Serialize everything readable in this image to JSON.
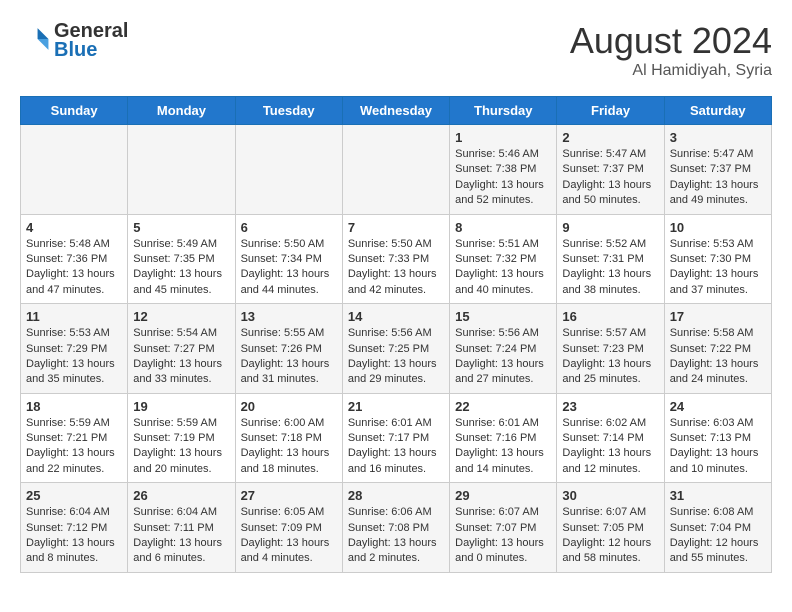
{
  "header": {
    "logo_line1": "General",
    "logo_line2": "Blue",
    "month_year": "August 2024",
    "location": "Al Hamidiyah, Syria"
  },
  "days_of_week": [
    "Sunday",
    "Monday",
    "Tuesday",
    "Wednesday",
    "Thursday",
    "Friday",
    "Saturday"
  ],
  "weeks": [
    [
      {
        "day": "",
        "text": ""
      },
      {
        "day": "",
        "text": ""
      },
      {
        "day": "",
        "text": ""
      },
      {
        "day": "",
        "text": ""
      },
      {
        "day": "1",
        "text": "Sunrise: 5:46 AM\nSunset: 7:38 PM\nDaylight: 13 hours\nand 52 minutes."
      },
      {
        "day": "2",
        "text": "Sunrise: 5:47 AM\nSunset: 7:37 PM\nDaylight: 13 hours\nand 50 minutes."
      },
      {
        "day": "3",
        "text": "Sunrise: 5:47 AM\nSunset: 7:37 PM\nDaylight: 13 hours\nand 49 minutes."
      }
    ],
    [
      {
        "day": "4",
        "text": "Sunrise: 5:48 AM\nSunset: 7:36 PM\nDaylight: 13 hours\nand 47 minutes."
      },
      {
        "day": "5",
        "text": "Sunrise: 5:49 AM\nSunset: 7:35 PM\nDaylight: 13 hours\nand 45 minutes."
      },
      {
        "day": "6",
        "text": "Sunrise: 5:50 AM\nSunset: 7:34 PM\nDaylight: 13 hours\nand 44 minutes."
      },
      {
        "day": "7",
        "text": "Sunrise: 5:50 AM\nSunset: 7:33 PM\nDaylight: 13 hours\nand 42 minutes."
      },
      {
        "day": "8",
        "text": "Sunrise: 5:51 AM\nSunset: 7:32 PM\nDaylight: 13 hours\nand 40 minutes."
      },
      {
        "day": "9",
        "text": "Sunrise: 5:52 AM\nSunset: 7:31 PM\nDaylight: 13 hours\nand 38 minutes."
      },
      {
        "day": "10",
        "text": "Sunrise: 5:53 AM\nSunset: 7:30 PM\nDaylight: 13 hours\nand 37 minutes."
      }
    ],
    [
      {
        "day": "11",
        "text": "Sunrise: 5:53 AM\nSunset: 7:29 PM\nDaylight: 13 hours\nand 35 minutes."
      },
      {
        "day": "12",
        "text": "Sunrise: 5:54 AM\nSunset: 7:27 PM\nDaylight: 13 hours\nand 33 minutes."
      },
      {
        "day": "13",
        "text": "Sunrise: 5:55 AM\nSunset: 7:26 PM\nDaylight: 13 hours\nand 31 minutes."
      },
      {
        "day": "14",
        "text": "Sunrise: 5:56 AM\nSunset: 7:25 PM\nDaylight: 13 hours\nand 29 minutes."
      },
      {
        "day": "15",
        "text": "Sunrise: 5:56 AM\nSunset: 7:24 PM\nDaylight: 13 hours\nand 27 minutes."
      },
      {
        "day": "16",
        "text": "Sunrise: 5:57 AM\nSunset: 7:23 PM\nDaylight: 13 hours\nand 25 minutes."
      },
      {
        "day": "17",
        "text": "Sunrise: 5:58 AM\nSunset: 7:22 PM\nDaylight: 13 hours\nand 24 minutes."
      }
    ],
    [
      {
        "day": "18",
        "text": "Sunrise: 5:59 AM\nSunset: 7:21 PM\nDaylight: 13 hours\nand 22 minutes."
      },
      {
        "day": "19",
        "text": "Sunrise: 5:59 AM\nSunset: 7:19 PM\nDaylight: 13 hours\nand 20 minutes."
      },
      {
        "day": "20",
        "text": "Sunrise: 6:00 AM\nSunset: 7:18 PM\nDaylight: 13 hours\nand 18 minutes."
      },
      {
        "day": "21",
        "text": "Sunrise: 6:01 AM\nSunset: 7:17 PM\nDaylight: 13 hours\nand 16 minutes."
      },
      {
        "day": "22",
        "text": "Sunrise: 6:01 AM\nSunset: 7:16 PM\nDaylight: 13 hours\nand 14 minutes."
      },
      {
        "day": "23",
        "text": "Sunrise: 6:02 AM\nSunset: 7:14 PM\nDaylight: 13 hours\nand 12 minutes."
      },
      {
        "day": "24",
        "text": "Sunrise: 6:03 AM\nSunset: 7:13 PM\nDaylight: 13 hours\nand 10 minutes."
      }
    ],
    [
      {
        "day": "25",
        "text": "Sunrise: 6:04 AM\nSunset: 7:12 PM\nDaylight: 13 hours\nand 8 minutes."
      },
      {
        "day": "26",
        "text": "Sunrise: 6:04 AM\nSunset: 7:11 PM\nDaylight: 13 hours\nand 6 minutes."
      },
      {
        "day": "27",
        "text": "Sunrise: 6:05 AM\nSunset: 7:09 PM\nDaylight: 13 hours\nand 4 minutes."
      },
      {
        "day": "28",
        "text": "Sunrise: 6:06 AM\nSunset: 7:08 PM\nDaylight: 13 hours\nand 2 minutes."
      },
      {
        "day": "29",
        "text": "Sunrise: 6:07 AM\nSunset: 7:07 PM\nDaylight: 13 hours\nand 0 minutes."
      },
      {
        "day": "30",
        "text": "Sunrise: 6:07 AM\nSunset: 7:05 PM\nDaylight: 12 hours\nand 58 minutes."
      },
      {
        "day": "31",
        "text": "Sunrise: 6:08 AM\nSunset: 7:04 PM\nDaylight: 12 hours\nand 55 minutes."
      }
    ]
  ]
}
